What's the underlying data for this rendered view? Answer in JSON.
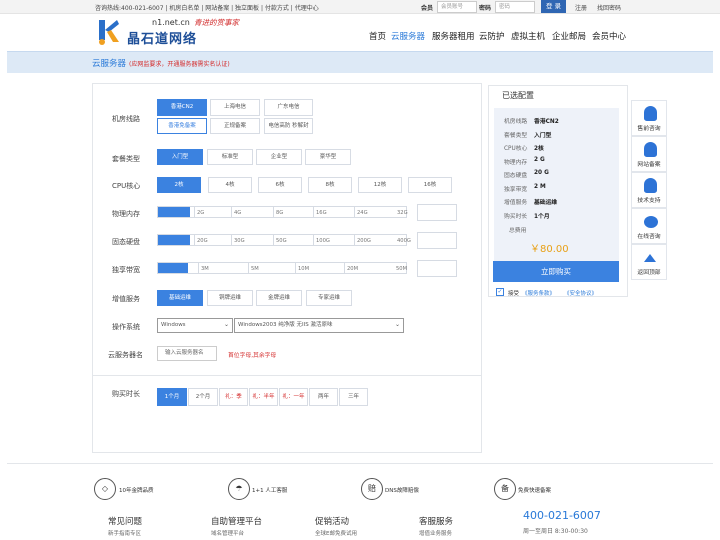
{
  "topbar": {
    "links": "咨询热线:400-021-6007 | 机房白名单 | 网站备案 | 独立面板 | 付款方式 | 代理中心",
    "member_label": "会员",
    "member_placeholder": "会员账号",
    "pwd_label": "密码",
    "pwd_placeholder": "密码",
    "login": "登 录",
    "register": "注册",
    "forgot": "找回密码"
  },
  "logo": {
    "domain": "n1.net.cn",
    "slogan": "青进的赏事家",
    "name": "晶石道网络"
  },
  "nav": [
    "首页",
    "云服务器",
    "服务器租用",
    "云防护",
    "虚拟主机",
    "企业邮局",
    "会员中心"
  ],
  "banner": {
    "title": "云服务器",
    "note": "(应网监要求，开通服务器需实名认证)"
  },
  "form": {
    "room": {
      "label": "机房线路",
      "options": [
        "香港CN2",
        "上海电信",
        "广东电信",
        "香港免备案",
        "正规备案",
        "电信高防 秒解封"
      ]
    },
    "plan": {
      "label": "套餐类型",
      "options": [
        "入门型",
        "标准型",
        "企业型",
        "豪华型"
      ]
    },
    "cpu": {
      "label": "CPU核心",
      "options": [
        "2核",
        "4核",
        "6核",
        "8核",
        "12核",
        "16核"
      ]
    },
    "mem": {
      "label": "物理内存",
      "ticks": [
        "2G",
        "4G",
        "8G",
        "16G",
        "24G",
        "32G"
      ],
      "level": 0.13
    },
    "disk": {
      "label": "固态硬盘",
      "ticks": [
        "20G",
        "30G",
        "50G",
        "100G",
        "200G",
        "400G"
      ],
      "level": 0.13
    },
    "bw": {
      "label": "独享带宽",
      "ticks": [
        "1M",
        "3M",
        "5M",
        "10M",
        "20M",
        "50M"
      ],
      "level": 0.12
    },
    "addon": {
      "label": "增值服务",
      "options": [
        "基础运维",
        "铜牌运维",
        "金牌运维",
        "专家运维"
      ]
    },
    "os": {
      "label": "操作系统",
      "os_value": "Windows",
      "ver_value": "Windows2003 纯净版 无IIS 激活原味"
    },
    "name": {
      "label": "云服务器名",
      "placeholder": "输入云服务器名",
      "hint": "首位字母,其余字母"
    },
    "period": {
      "label": "购买时长",
      "options": [
        "1个月",
        "2个月",
        "礼：季",
        "礼：半年",
        "礼：一年",
        "两年",
        "三年"
      ]
    }
  },
  "summary": {
    "title": "已选配置",
    "rows": [
      {
        "k": "机房线路",
        "v": "香港CN2"
      },
      {
        "k": "套餐类型",
        "v": "入门型"
      },
      {
        "k": "CPU核心",
        "v": "2核"
      },
      {
        "k": "物理内存",
        "v": "2 G"
      },
      {
        "k": "固态硬盘",
        "v": "20 G"
      },
      {
        "k": "独享带宽",
        "v": "2 M"
      },
      {
        "k": "增值服务",
        "v": "基础运维"
      },
      {
        "k": "购买时长",
        "v": "1个月"
      }
    ],
    "total_label": "总费用",
    "price": "￥80.00",
    "buy": "立即购买",
    "agree": "接受",
    "tos": "《服务条款》",
    "safety": "《安全协议》"
  },
  "side": [
    "售前咨询",
    "网站备案",
    "技术支持",
    "在线咨询",
    "返回顶部"
  ],
  "features": [
    {
      "icon": "◇",
      "text": "10年金牌品质"
    },
    {
      "icon": "☂",
      "text": "1+1 人工客服"
    },
    {
      "icon": "赔",
      "text": "DNS故障赔偿"
    },
    {
      "icon": "备",
      "text": "免费快速备案"
    }
  ],
  "footer": [
    {
      "title": "常见问题",
      "sub": "新手指南专区"
    },
    {
      "title": "自助管理平台",
      "sub": "域名管理平台"
    },
    {
      "title": "促销活动",
      "sub": "全球E邮免费试用"
    },
    {
      "title": "客服服务",
      "sub": "增值业务服务"
    }
  ],
  "phone": "400-021-6007",
  "hours": "周一至周日 8:30-00:30",
  "colors": {
    "accent": "#2979d8",
    "selected": "#3b82e0",
    "price": "#e8a117",
    "hint": "#d42b2b"
  }
}
